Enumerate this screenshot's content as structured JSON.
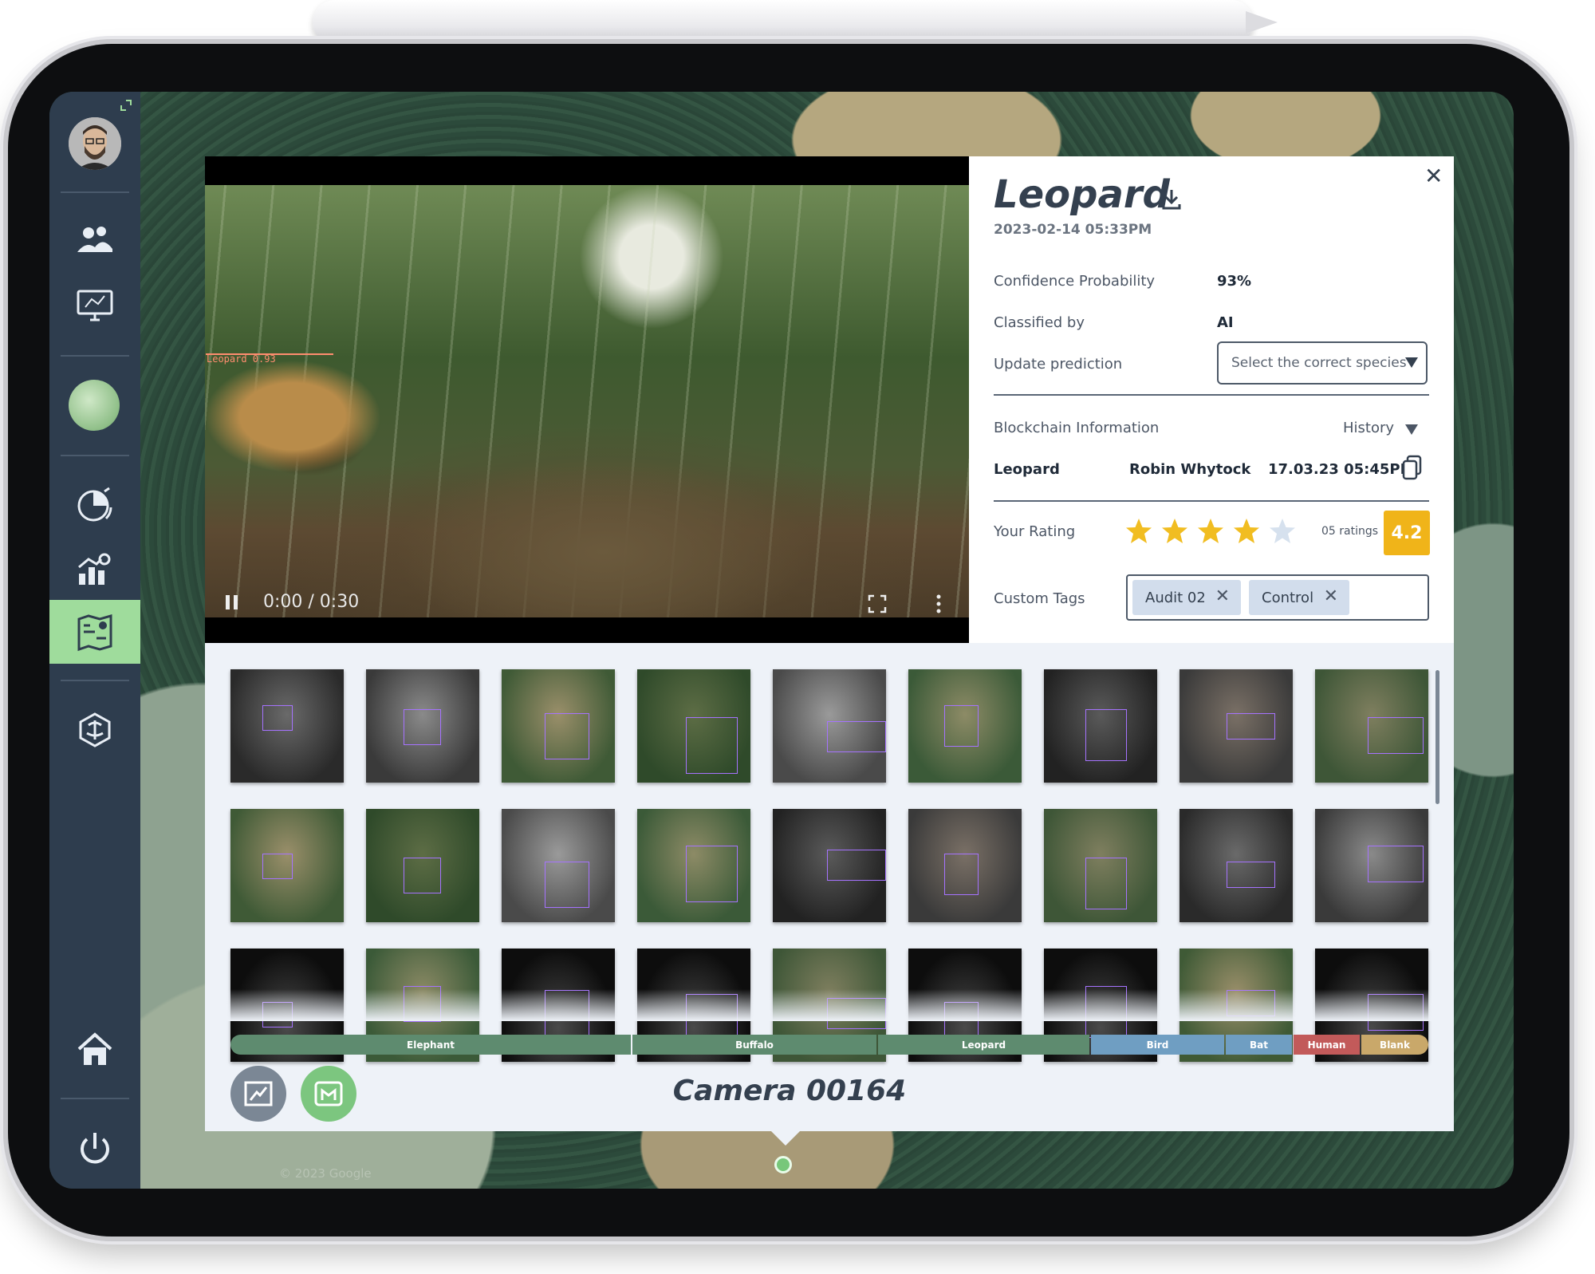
{
  "detail": {
    "title": "Leopard",
    "datetime": "2023-02-14 05:33PM",
    "close_glyph": "✕",
    "confidence_label": "Confidence Probability",
    "confidence_value": "93%",
    "classified_label": "Classified by",
    "classified_value": "AI",
    "update_label": "Update prediction",
    "species_placeholder": "Select the correct species",
    "blockchain_label": "Blockchain Information",
    "history_label": "History",
    "blockchain_record": {
      "species": "Leopard",
      "user": "Robin Whytock",
      "timestamp": "17.03.23 05:45PM"
    },
    "rating_label": "Your Rating",
    "rating_stars": 4,
    "rating_max": 5,
    "ratings_count": "05 ratings",
    "rating_average": "4.2",
    "tags_label": "Custom Tags",
    "tags": [
      "Audit 02",
      "Control"
    ]
  },
  "video": {
    "time": "0:00 / 0:30",
    "bbox_label": "Leopard 0.93"
  },
  "categories": [
    {
      "label": "Elephant",
      "color": "#5e8b6f"
    },
    {
      "label": "Buffalo",
      "color": "#5e8b6f"
    },
    {
      "label": "Leopard",
      "color": "#5e8b6f"
    },
    {
      "label": "Bird",
      "color": "#6f9ec2"
    },
    {
      "label": "Bat",
      "color": "#6f9ec2"
    },
    {
      "label": "Human",
      "color": "#c25a5a"
    },
    {
      "label": "Blank",
      "color": "#c9a86a"
    }
  ],
  "camera_title": "Camera 00164",
  "map_attribution": "© 2023 Google",
  "icons": {
    "sidebar": [
      "avatar",
      "users-icon",
      "monitor-icon",
      "globe-icon",
      "chart-icon",
      "analytics-icon",
      "map-icon",
      "brain-icon",
      "home-icon",
      "power-icon"
    ],
    "bottom": [
      "image-review-icon",
      "video-review-icon"
    ]
  },
  "colors": {
    "sidebar": "#2e3d4e",
    "active": "#9fdc9c",
    "rating": "#f0b419",
    "star": "#f1bd21",
    "star_empty": "#d6e1ee"
  }
}
